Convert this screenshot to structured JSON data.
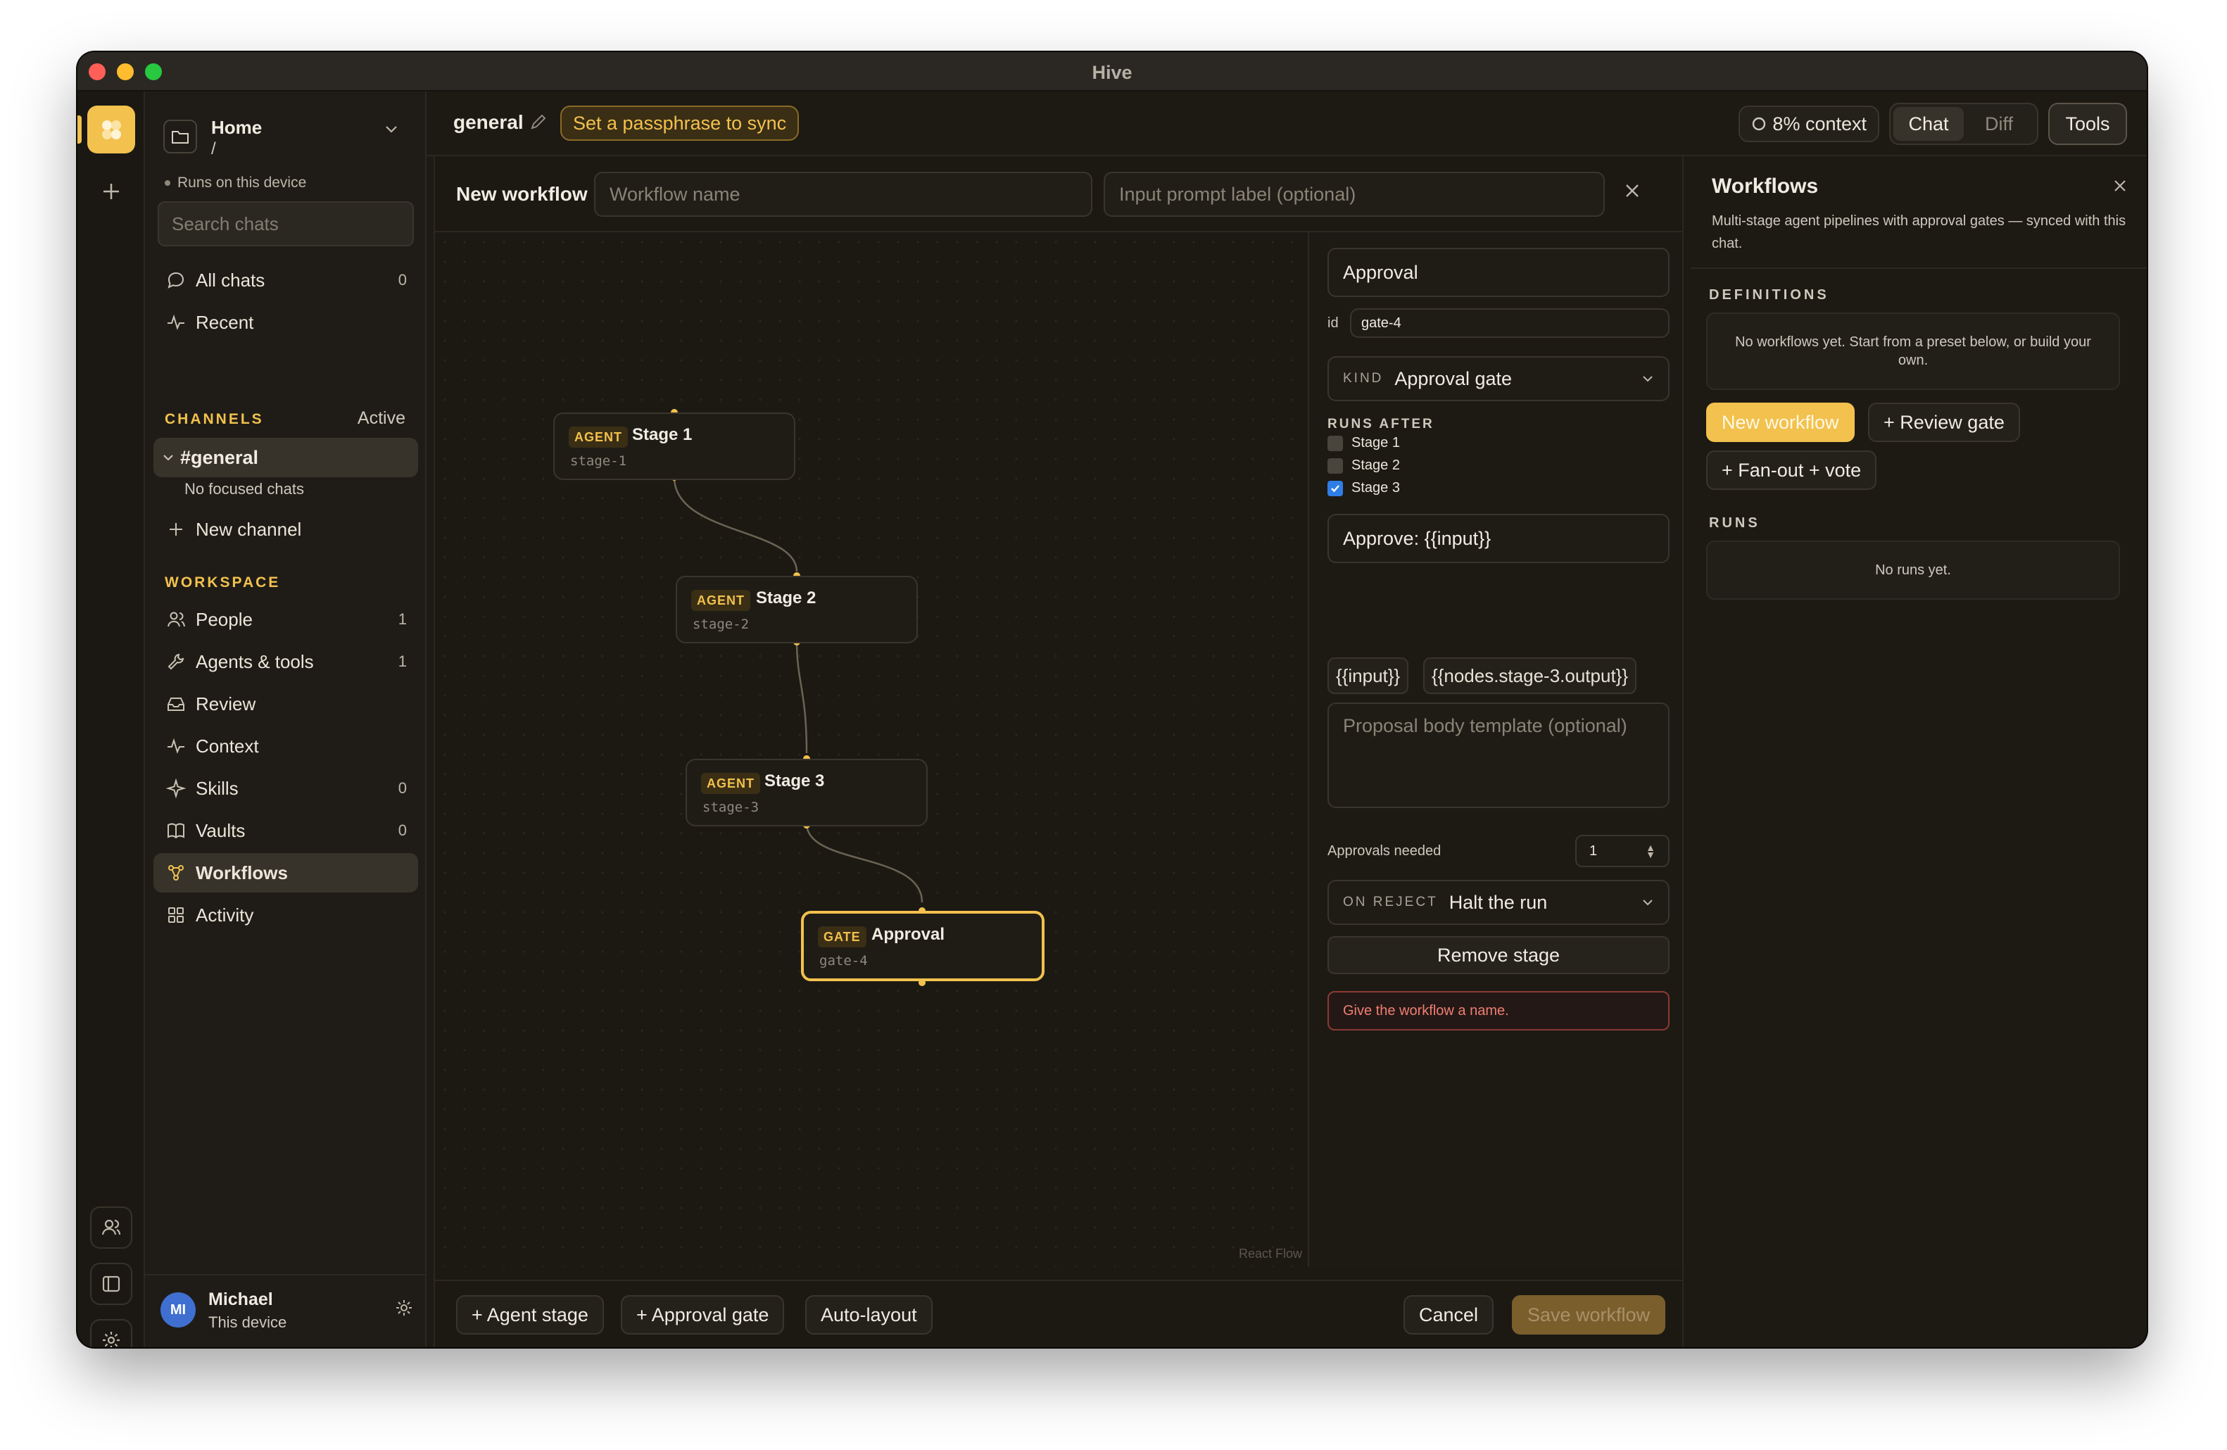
{
  "window": {
    "title": "Hive"
  },
  "sidebar": {
    "workspace_name": "Home",
    "workspace_path": "/",
    "device_status": "Runs on this device",
    "search_placeholder": "Search chats",
    "top_items": [
      {
        "label": "All chats",
        "count": "0"
      },
      {
        "label": "Recent",
        "count": ""
      }
    ],
    "channels_label": "CHANNELS",
    "channels_status": "Active",
    "active_channel": "#general",
    "channel_note": "No focused chats",
    "new_channel_label": "New channel",
    "workspace_label": "WORKSPACE",
    "workspace_items": [
      {
        "label": "People",
        "count": "1"
      },
      {
        "label": "Agents & tools",
        "count": "1"
      },
      {
        "label": "Review",
        "count": ""
      },
      {
        "label": "Context",
        "count": ""
      },
      {
        "label": "Skills",
        "count": "0"
      },
      {
        "label": "Vaults",
        "count": "0"
      },
      {
        "label": "Workflows",
        "count": ""
      },
      {
        "label": "Activity",
        "count": ""
      }
    ],
    "user": {
      "initials": "MI",
      "name": "Michael",
      "subtitle": "This device"
    }
  },
  "topbar": {
    "channel": "general",
    "passphrase_label": "Set a passphrase to sync",
    "context_label": "8% context",
    "tabs": [
      "Chat",
      "Diff"
    ],
    "active_tab": "Chat",
    "tools_label": "Tools"
  },
  "editor": {
    "title": "New workflow",
    "name_placeholder": "Workflow name",
    "prompt_placeholder": "Input prompt label (optional)",
    "nodes": [
      {
        "kind": "AGENT",
        "title": "Stage 1",
        "id": "stage-1"
      },
      {
        "kind": "AGENT",
        "title": "Stage 2",
        "id": "stage-2"
      },
      {
        "kind": "AGENT",
        "title": "Stage 3",
        "id": "stage-3"
      },
      {
        "kind": "GATE",
        "title": "Approval",
        "id": "gate-4"
      }
    ],
    "attribution": "React Flow",
    "inspector": {
      "stage_name": "Approval",
      "id_label": "id",
      "id_value": "gate-4",
      "kind_label": "KIND",
      "kind_value": "Approval gate",
      "runs_after_label": "RUNS AFTER",
      "runs_after": [
        {
          "label": "Stage 1",
          "checked": false
        },
        {
          "label": "Stage 2",
          "checked": false
        },
        {
          "label": "Stage 3",
          "checked": true
        }
      ],
      "prompt_value": "Approve: {{input}}",
      "tokens": [
        "{{input}}",
        "{{nodes.stage-3.output}}"
      ],
      "body_placeholder": "Proposal body template (optional)",
      "approvals_label": "Approvals needed",
      "approvals_value": "1",
      "on_reject_label": "ON REJECT",
      "on_reject_value": "Halt the run",
      "remove_label": "Remove stage",
      "error_text": "Give the workflow a name."
    },
    "footer": {
      "add_agent": "+ Agent stage",
      "add_gate": "+ Approval gate",
      "auto_layout": "Auto-layout",
      "cancel": "Cancel",
      "save": "Save workflow"
    }
  },
  "workflows_panel": {
    "title": "Workflows",
    "description": "Multi-stage agent pipelines with approval gates — synced with this chat.",
    "definitions_label": "DEFINITIONS",
    "definitions_empty": "No workflows yet. Start from a preset below, or build your own.",
    "new_workflow": "New workflow",
    "review_gate": "+ Review gate",
    "fanout_vote": "+ Fan-out + vote",
    "runs_label": "RUNS",
    "runs_empty": "No runs yet."
  },
  "colors": {
    "accent": "#f2c14e",
    "background": "#1d1a14",
    "error": "#ef7f72",
    "checkbox": "#2f7ee6"
  }
}
